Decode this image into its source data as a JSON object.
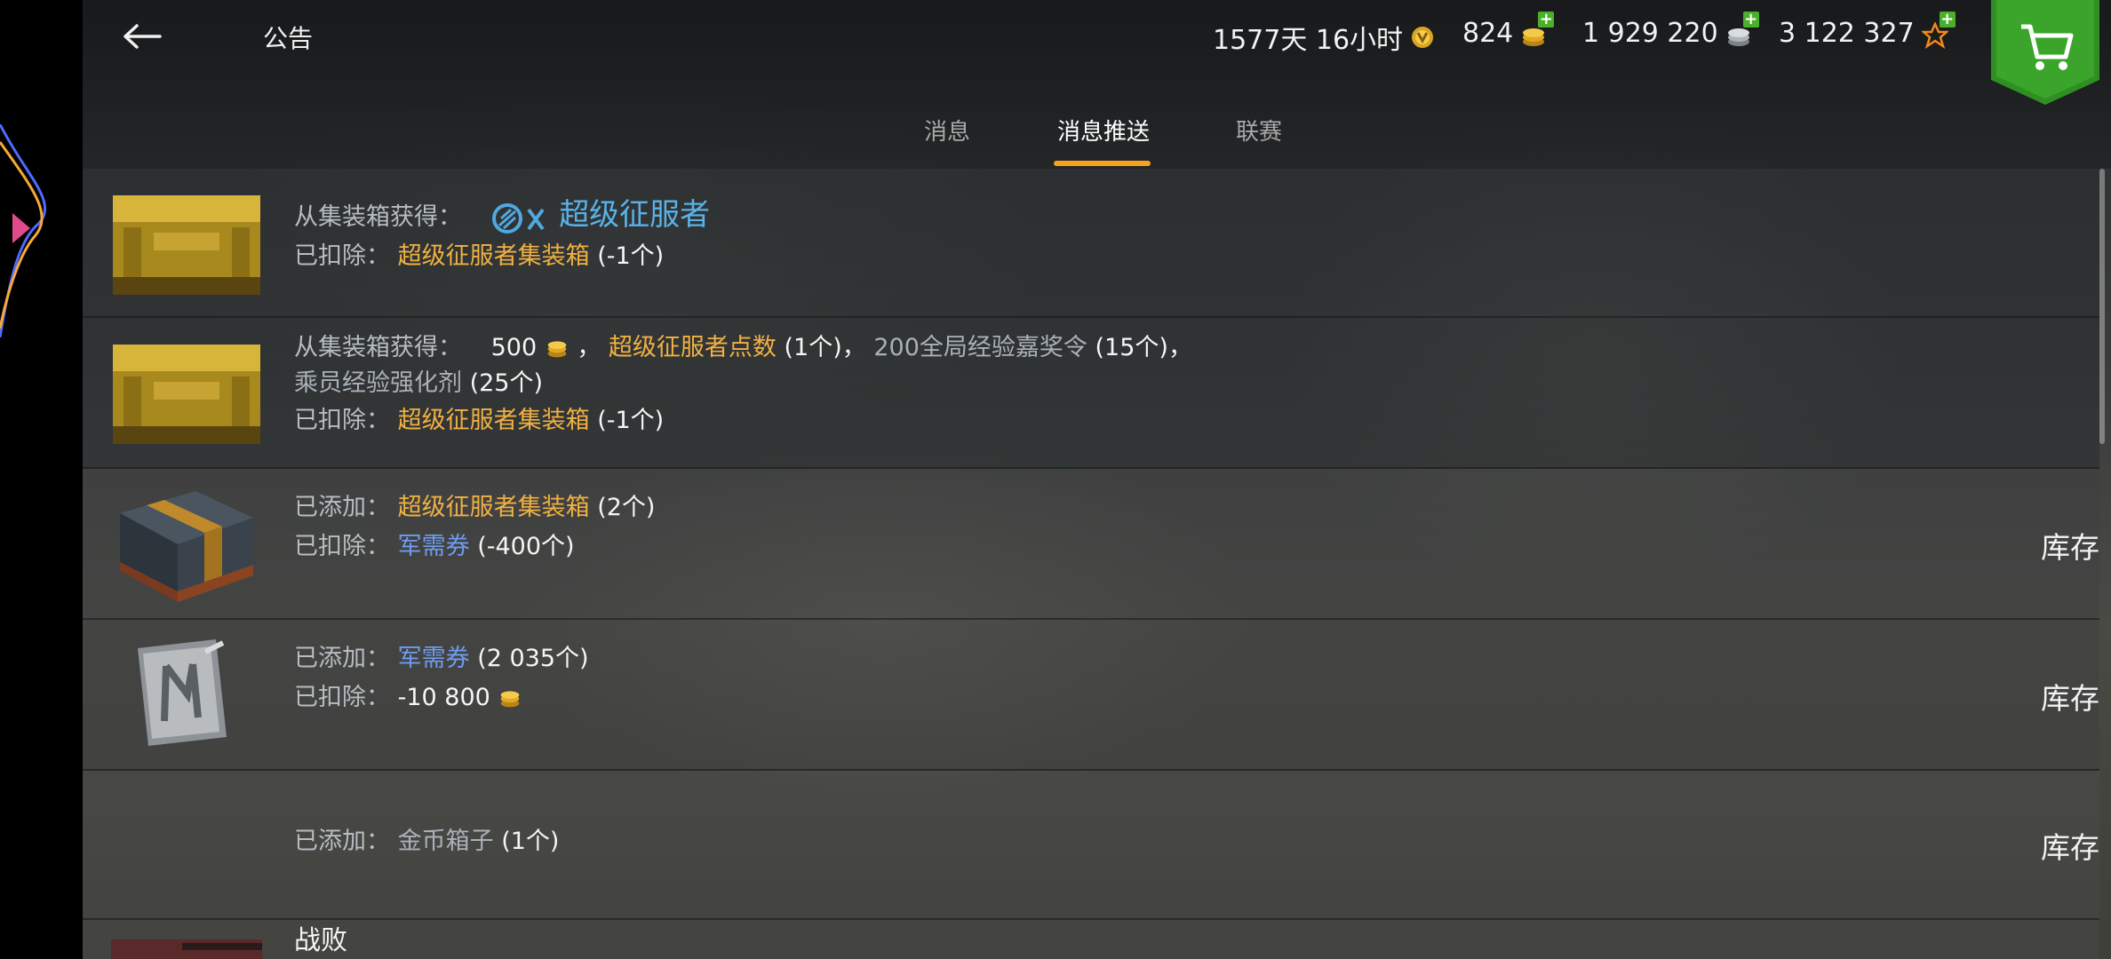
{
  "header": {
    "title": "公告",
    "premium_time": "1577天 16小时",
    "gold": "824",
    "credits": "1 929 220",
    "free_xp": "3 122 327"
  },
  "tabs": [
    {
      "label": "消息"
    },
    {
      "label": "消息推送"
    },
    {
      "label": "联赛"
    }
  ],
  "active_tab": "消息推送",
  "messages": [
    {
      "lbl1": "从集装箱获得：",
      "reward": "超级征服者",
      "lbl2": "已扣除：",
      "deduct_item": "超级征服者集装箱",
      "deduct_qty": "(-1个)"
    },
    {
      "lbl1": "从集装箱获得：",
      "gold_amount": "500",
      "sep1": "，",
      "item1": "超级征服者点数",
      "item1_qty": "(1个)",
      "sep2": "，",
      "item2": "200全局经验嘉奖令",
      "item2_qty": "(15个)",
      "sep3": "，",
      "item3": "乘员经验强化剂",
      "item3_qty": "(25个)",
      "lbl2": "已扣除：",
      "deduct_item": "超级征服者集装箱",
      "deduct_qty": "(-1个)"
    },
    {
      "lbl1": "已添加：",
      "add_item": "超级征服者集装箱",
      "add_qty": "(2个)",
      "lbl2": "已扣除：",
      "deduct_item": "军需券",
      "deduct_qty": "(-400个)",
      "button": "库存"
    },
    {
      "lbl1": "已添加：",
      "add_item": "军需券",
      "add_qty": "(2 035个)",
      "lbl2": "已扣除：",
      "deduct_amount": "-10 800",
      "button": "库存"
    },
    {
      "lbl1": "已添加：",
      "add_item": "金币箱子",
      "add_qty": "(1个)",
      "button": "库存"
    },
    {
      "title": "战败"
    }
  ],
  "icons": {
    "back": "back-arrow-icon",
    "premium": "premium-account-icon",
    "gold": "gold-coins-icon",
    "credits": "credits-coins-icon",
    "xp": "free-xp-star-icon",
    "shop": "shopping-cart-icon"
  },
  "colors": {
    "accent": "#f5a31d",
    "plus_green": "#4caf2a",
    "shop_green": "#2f8f22",
    "item_orange": "#f0b142",
    "item_blue": "#6f9cf0",
    "reward_blue": "#59b2e8"
  }
}
